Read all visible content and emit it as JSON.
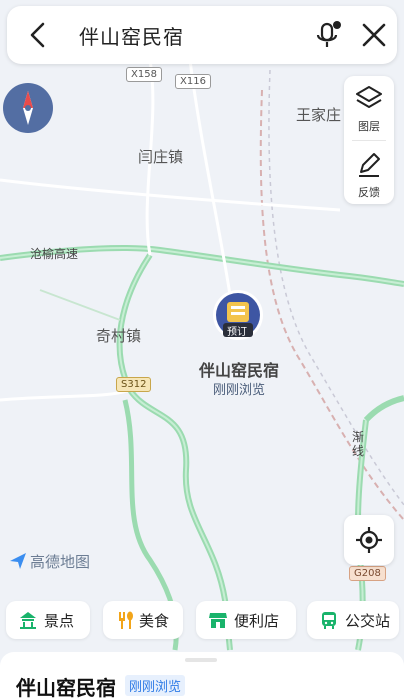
{
  "search": {
    "query": "伴山窑民宿"
  },
  "map": {
    "labels": {
      "town_top_right": "王家庄",
      "town_middle": "闫庄镇",
      "town_left": "奇村镇",
      "expressway": "沧榆高速",
      "rail_right": "渐线"
    },
    "road_badges": [
      "X158",
      "X116",
      "S312",
      "G208"
    ],
    "poi": {
      "booking_tag": "预订",
      "name": "伴山窑民宿",
      "status": "刚刚浏览"
    },
    "logo": "高德地图"
  },
  "tools": {
    "layers": "图层",
    "feedback": "反馈"
  },
  "categories": [
    {
      "label": "景点",
      "icon": "scenic-icon"
    },
    {
      "label": "美食",
      "icon": "food-icon"
    },
    {
      "label": "便利店",
      "icon": "store-icon"
    },
    {
      "label": "公交站",
      "icon": "bus-icon"
    }
  ],
  "card": {
    "title": "伴山窑民宿",
    "badge": "刚刚浏览"
  },
  "colors": {
    "road_green": "#93d9a8",
    "accent_green": "#19b36b",
    "blue": "#2e7be6"
  }
}
